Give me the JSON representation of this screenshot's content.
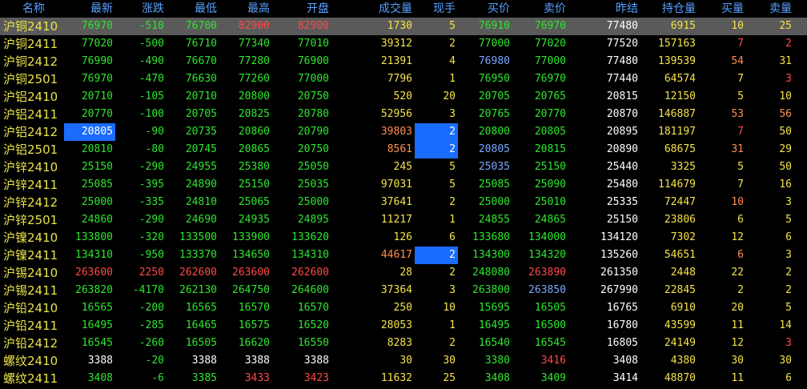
{
  "headers": [
    "名称",
    "最新",
    "涨跌",
    "最低",
    "最高",
    "开盘",
    "成交量",
    "现手",
    "买价",
    "卖价",
    "昨结",
    "持仓量",
    "买量",
    "卖量"
  ],
  "colors": {
    "down": "#2ee62e",
    "up": "#ff4a4a",
    "flat": "#ffffff",
    "volume": "#f5e24a",
    "volume_alt": "#ff9050",
    "blue": "#7aa8ff",
    "highlight": "#1a6cff",
    "selected_row": "#5a5a5a"
  },
  "rows": [
    {
      "name": "沪铜2410",
      "last": "76970",
      "chg": "-510",
      "low": "76700",
      "high": "82900",
      "open": "82900",
      "vol": "1730",
      "cur": "5",
      "bid": "76910",
      "ask": "76970",
      "pre": "77480",
      "oi": "6915",
      "bq": "10",
      "aq": "25"
    },
    {
      "name": "沪铜2411",
      "last": "77020",
      "chg": "-500",
      "low": "76710",
      "high": "77340",
      "open": "77010",
      "vol": "39312",
      "cur": "2",
      "bid": "77000",
      "ask": "77020",
      "pre": "77520",
      "oi": "157163",
      "bq": "7",
      "aq": "2"
    },
    {
      "name": "沪铜2412",
      "last": "76990",
      "chg": "-490",
      "low": "76670",
      "high": "77280",
      "open": "76900",
      "vol": "21391",
      "cur": "4",
      "bid": "76980",
      "ask": "77000",
      "pre": "77480",
      "oi": "139539",
      "bq": "54",
      "aq": "31"
    },
    {
      "name": "沪铜2501",
      "last": "76970",
      "chg": "-470",
      "low": "76630",
      "high": "77260",
      "open": "77000",
      "vol": "7796",
      "cur": "1",
      "bid": "76950",
      "ask": "76970",
      "pre": "77440",
      "oi": "64574",
      "bq": "7",
      "aq": "3"
    },
    {
      "name": "沪铝2410",
      "last": "20710",
      "chg": "-105",
      "low": "20710",
      "high": "20800",
      "open": "20750",
      "vol": "520",
      "cur": "20",
      "bid": "20705",
      "ask": "20765",
      "pre": "20815",
      "oi": "12150",
      "bq": "5",
      "aq": "10"
    },
    {
      "name": "沪铝2411",
      "last": "20770",
      "chg": "-100",
      "low": "20705",
      "high": "20825",
      "open": "20780",
      "vol": "52956",
      "cur": "3",
      "bid": "20765",
      "ask": "20770",
      "pre": "20870",
      "oi": "146887",
      "bq": "53",
      "aq": "56"
    },
    {
      "name": "沪铝2412",
      "last": "20805",
      "chg": "-90",
      "low": "20735",
      "high": "20860",
      "open": "20790",
      "vol": "39803",
      "cur": "2",
      "bid": "20800",
      "ask": "20805",
      "pre": "20895",
      "oi": "181197",
      "bq": "7",
      "aq": "50"
    },
    {
      "name": "沪铝2501",
      "last": "20810",
      "chg": "-80",
      "low": "20745",
      "high": "20865",
      "open": "20750",
      "vol": "8561",
      "cur": "2",
      "bid": "20805",
      "ask": "20815",
      "pre": "20890",
      "oi": "68675",
      "bq": "31",
      "aq": "29"
    },
    {
      "name": "沪锌2410",
      "last": "25150",
      "chg": "-290",
      "low": "24955",
      "high": "25380",
      "open": "25050",
      "vol": "245",
      "cur": "5",
      "bid": "25035",
      "ask": "25150",
      "pre": "25440",
      "oi": "3325",
      "bq": "5",
      "aq": "50"
    },
    {
      "name": "沪锌2411",
      "last": "25085",
      "chg": "-395",
      "low": "24890",
      "high": "25150",
      "open": "25035",
      "vol": "97031",
      "cur": "5",
      "bid": "25085",
      "ask": "25090",
      "pre": "25480",
      "oi": "114679",
      "bq": "7",
      "aq": "16"
    },
    {
      "name": "沪锌2412",
      "last": "25000",
      "chg": "-335",
      "low": "24810",
      "high": "25065",
      "open": "25000",
      "vol": "37641",
      "cur": "2",
      "bid": "25000",
      "ask": "25010",
      "pre": "25335",
      "oi": "72447",
      "bq": "10",
      "aq": "3"
    },
    {
      "name": "沪锌2501",
      "last": "24860",
      "chg": "-290",
      "low": "24690",
      "high": "24935",
      "open": "24895",
      "vol": "11217",
      "cur": "1",
      "bid": "24855",
      "ask": "24865",
      "pre": "25150",
      "oi": "23806",
      "bq": "6",
      "aq": "5"
    },
    {
      "name": "沪镍2410",
      "last": "133800",
      "chg": "-320",
      "low": "133500",
      "high": "133900",
      "open": "133620",
      "vol": "126",
      "cur": "6",
      "bid": "133680",
      "ask": "134000",
      "pre": "134120",
      "oi": "7302",
      "bq": "12",
      "aq": "6"
    },
    {
      "name": "沪镍2411",
      "last": "134310",
      "chg": "-950",
      "low": "133370",
      "high": "134650",
      "open": "134310",
      "vol": "44617",
      "cur": "2",
      "bid": "134300",
      "ask": "134320",
      "pre": "135260",
      "oi": "54651",
      "bq": "6",
      "aq": "3"
    },
    {
      "name": "沪锡2410",
      "last": "263600",
      "chg": "2250",
      "low": "262600",
      "high": "263600",
      "open": "262600",
      "vol": "28",
      "cur": "2",
      "bid": "248080",
      "ask": "263890",
      "pre": "261350",
      "oi": "2448",
      "bq": "22",
      "aq": "2"
    },
    {
      "name": "沪锡2411",
      "last": "263820",
      "chg": "-4170",
      "low": "262130",
      "high": "264750",
      "open": "264600",
      "vol": "37364",
      "cur": "3",
      "bid": "263800",
      "ask": "263850",
      "pre": "267990",
      "oi": "22845",
      "bq": "2",
      "aq": "2"
    },
    {
      "name": "沪铅2410",
      "last": "16565",
      "chg": "-200",
      "low": "16565",
      "high": "16570",
      "open": "16570",
      "vol": "250",
      "cur": "10",
      "bid": "15695",
      "ask": "16505",
      "pre": "16765",
      "oi": "6910",
      "bq": "20",
      "aq": "5"
    },
    {
      "name": "沪铅2411",
      "last": "16495",
      "chg": "-285",
      "low": "16465",
      "high": "16575",
      "open": "16520",
      "vol": "28053",
      "cur": "1",
      "bid": "16495",
      "ask": "16500",
      "pre": "16780",
      "oi": "43599",
      "bq": "11",
      "aq": "14"
    },
    {
      "name": "沪铅2412",
      "last": "16545",
      "chg": "-260",
      "low": "16505",
      "high": "16620",
      "open": "16550",
      "vol": "8283",
      "cur": "2",
      "bid": "16540",
      "ask": "16545",
      "pre": "16805",
      "oi": "24149",
      "bq": "12",
      "aq": "3"
    },
    {
      "name": "螺纹2410",
      "last": "3388",
      "chg": "-20",
      "low": "3388",
      "high": "3388",
      "open": "3388",
      "vol": "30",
      "cur": "30",
      "bid": "3380",
      "ask": "3416",
      "pre": "3408",
      "oi": "4380",
      "bq": "30",
      "aq": "30"
    },
    {
      "name": "螺纹2411",
      "last": "3408",
      "chg": "-6",
      "low": "3385",
      "high": "3433",
      "open": "3423",
      "vol": "11632",
      "cur": "25",
      "bid": "3408",
      "ask": "3409",
      "pre": "3414",
      "oi": "48870",
      "bq": "11",
      "aq": "6"
    }
  ]
}
